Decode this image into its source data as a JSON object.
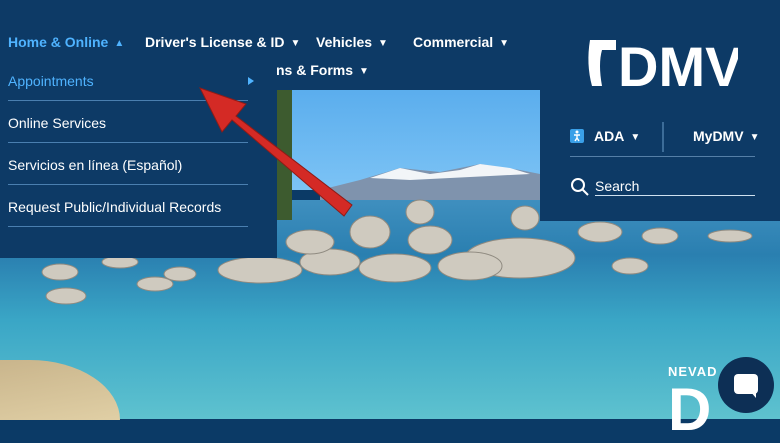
{
  "nav": {
    "items": [
      {
        "label": "Home & Online",
        "active": true
      },
      {
        "label": "Driver's License & ID"
      },
      {
        "label": "Vehicles"
      },
      {
        "label": "Commercial"
      },
      {
        "label": "ns & Forms"
      }
    ]
  },
  "dropdown": {
    "items": [
      {
        "label": "Appointments",
        "active": true,
        "has_submenu": true
      },
      {
        "label": "Online Services"
      },
      {
        "label": "Servicios en línea (Español)"
      },
      {
        "label": "Request Public/Individual Records"
      }
    ]
  },
  "logo": {
    "text": "DMV"
  },
  "utility": {
    "ada_label": "ADA",
    "mydmv_label": "MyDMV",
    "search_label": "Search"
  },
  "hero": {
    "partial_text_1": "NEVAD",
    "partial_text_2": "D"
  },
  "colors": {
    "nav_bg": "#0d3a66",
    "accent": "#4fb3ff",
    "annotation_arrow": "#d42a25"
  },
  "icons": [
    "caret-down-icon",
    "caret-up-icon",
    "caret-right-icon",
    "accessibility-icon",
    "search-icon",
    "chat-icon"
  ]
}
